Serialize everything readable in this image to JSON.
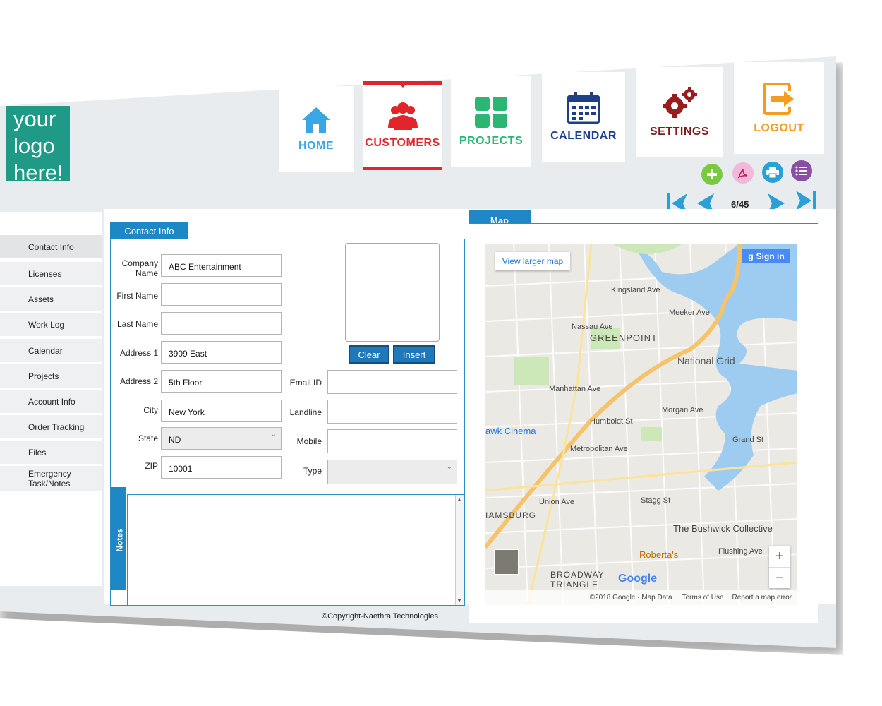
{
  "logo": {
    "lines": [
      "your",
      "logo",
      "here!"
    ]
  },
  "nav": [
    {
      "label": "HOME",
      "color": "#3aa6e3",
      "icon": "home-icon"
    },
    {
      "label": "CUSTOMERS",
      "color": "#e3242b",
      "icon": "users-icon"
    },
    {
      "label": "PROJECTS",
      "color": "#2bb673",
      "icon": "grid-icon"
    },
    {
      "label": "CALENDAR",
      "color": "#1f3e8a",
      "icon": "calendar-icon"
    },
    {
      "label": "SETTINGS",
      "color": "#7a1a1a",
      "icon": "gear-icon"
    },
    {
      "label": "LOGOUT",
      "color": "#f39c1f",
      "icon": "logout-icon"
    }
  ],
  "actions": [
    {
      "icon": "add-icon",
      "color": "#7ac943"
    },
    {
      "icon": "pdf-icon",
      "color": "#e98fc4"
    },
    {
      "icon": "print-icon",
      "color": "#2a9fd8"
    },
    {
      "icon": "list-icon",
      "color": "#8a4ea3"
    }
  ],
  "pager": {
    "count": "6/45"
  },
  "sidebar": [
    "Contact Info",
    "Licenses",
    "Assets",
    "Work Log",
    "Calendar",
    "Projects",
    "Account Info",
    "Order Tracking",
    "Files",
    "Emergency Task/Notes"
  ],
  "contact": {
    "tab": "Contact Info",
    "company_label_1": "Company",
    "company_label_2": "Name",
    "company": "ABC Entertainment",
    "first_name_label": "First Name",
    "first_name": "",
    "last_name_label": "Last Name",
    "last_name": "",
    "address1_label": "Address 1",
    "address1": "3909 East",
    "address2_label": "Address 2",
    "address2": "5th Floor",
    "city_label": "City",
    "city": "New York",
    "state_label": "State",
    "state": "ND",
    "zip_label": "ZIP",
    "zip": "10001",
    "email_label": "Email ID",
    "email": "",
    "landline_label": "Landline",
    "landline": "",
    "mobile_label": "Mobile",
    "mobile": "",
    "type_label": "Type",
    "type": "",
    "clear_label": "Clear",
    "insert_label": "Insert"
  },
  "notes": {
    "tab": "Notes"
  },
  "map": {
    "tab": "Map",
    "view_larger": "View larger map",
    "sign_in": "Sign in",
    "labels": [
      "GREENPOINT",
      "National Grid",
      "Metropolitan Ave",
      "Grand St",
      "Stagg St",
      "The Bushwick Collective",
      "Roberta's",
      "BROADWAY TRIANGLE",
      "IAMSBURG",
      "awk Cinema",
      "Humboldt St",
      "Morgan Ave",
      "Flushing Ave",
      "Nassau Ave",
      "Meeker Ave",
      "Kingsland Ave",
      "Manhattan Ave",
      "Union Ave"
    ],
    "zoom_in": "+",
    "zoom_out": "−",
    "brand": "Google",
    "attribution": "©2018 Google · Map Data",
    "terms": "Terms of Use",
    "report": "Report a map error"
  },
  "footer": {
    "text": "©Copyright-Naethra Technologies"
  }
}
